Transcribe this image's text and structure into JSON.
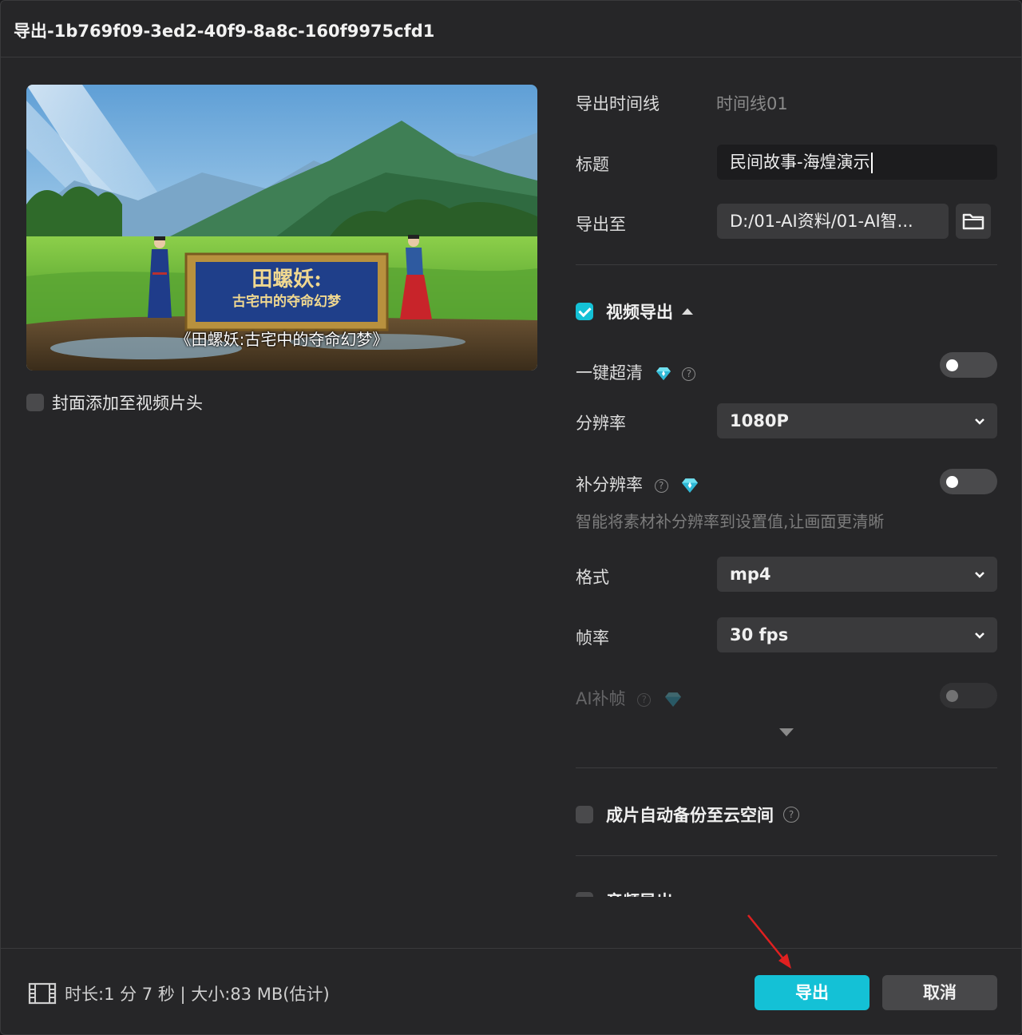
{
  "dialog": {
    "title": "导出-1b769f09-3ed2-40f9-8a8c-160f9975cfd1"
  },
  "preview": {
    "sign_title": "田螺妖:",
    "sign_subtitle": "古宅中的夺命幻梦",
    "subtitle_text": "《田螺妖:古宅中的夺命幻梦》"
  },
  "cover": {
    "label": "封面添加至视频片头",
    "checked": false
  },
  "form": {
    "timeline_label": "导出时间线",
    "timeline_value": "时间线01",
    "title_label": "标题",
    "title_value": "民间故事-海煌演示",
    "export_to_label": "导出至",
    "export_to_value": "D:/01-AI资料/01-AI智..."
  },
  "video_export": {
    "label": "视频导出",
    "checked": true,
    "one_click_hd_label": "一键超清",
    "one_click_hd_on": false,
    "resolution_label": "分辨率",
    "resolution_value": "1080P",
    "super_res_label": "补分辨率",
    "super_res_on": false,
    "super_res_hint": "智能将素材补分辨率到设置值,让画面更清晰",
    "format_label": "格式",
    "format_value": "mp4",
    "framerate_label": "帧率",
    "framerate_value": "30 fps",
    "ai_frame_label": "AI补帧",
    "ai_frame_on": false
  },
  "cloud_backup": {
    "label": "成片自动备份至云空间",
    "checked": false
  },
  "audio_export": {
    "label": "音频导出"
  },
  "footer": {
    "info": "时长:1 分 7 秒 | 大小:83 MB(估计)",
    "export_button": "导出",
    "cancel_button": "取消"
  },
  "colors": {
    "accent": "#14c1d6",
    "background": "#262628",
    "annotation_arrow": "#e02020"
  }
}
